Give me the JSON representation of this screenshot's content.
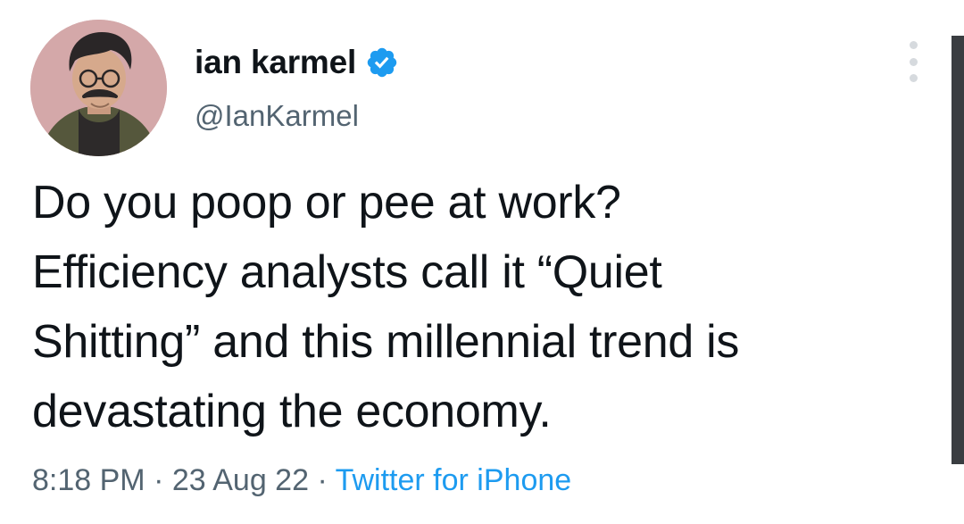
{
  "author": {
    "display_name": "ian karmel",
    "handle": "@IanKarmel",
    "verified": true
  },
  "tweet": {
    "lines": [
      "Do you poop or pee at work?",
      "Efficiency analysts call it “Quiet",
      "Shitting” and this millennial trend is",
      "devastating the economy."
    ],
    "time": "8:18 PM",
    "separator": " · ",
    "date": "23 Aug 22",
    "source": "Twitter for iPhone"
  },
  "icons": {
    "verified": "verified-badge-icon",
    "more": "more-options-icon"
  },
  "colors": {
    "text": "#0f1419",
    "secondary": "#536471",
    "accent": "#1d9bf0",
    "avatar_bg": "#d4a8a9"
  }
}
